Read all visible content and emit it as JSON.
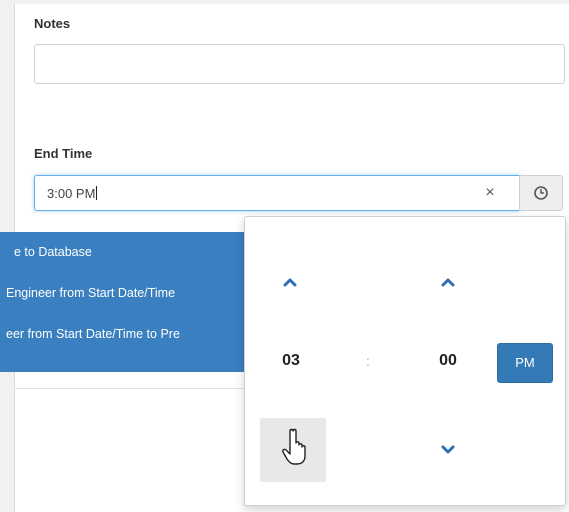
{
  "notes": {
    "label": "Notes",
    "value": ""
  },
  "end_time": {
    "label": "End Time",
    "value": "3:00 PM",
    "clear_glyph": "×"
  },
  "dropdown": {
    "items": [
      {
        "label": "e to Database"
      },
      {
        "label": "Engineer from Start Date/Time"
      },
      {
        "label": "eer from Start Date/Time to Pre"
      }
    ]
  },
  "time_picker": {
    "hour": "03",
    "minute": "00",
    "separator": ":",
    "meridian": "PM"
  },
  "colors": {
    "accent": "#337ab7",
    "list_bg": "#3a7fc0",
    "chevron": "#2c6fb3"
  },
  "icons": [
    "clock-icon",
    "close-icon",
    "chevron-up-icon",
    "chevron-down-icon",
    "hand-pointer-icon"
  ]
}
